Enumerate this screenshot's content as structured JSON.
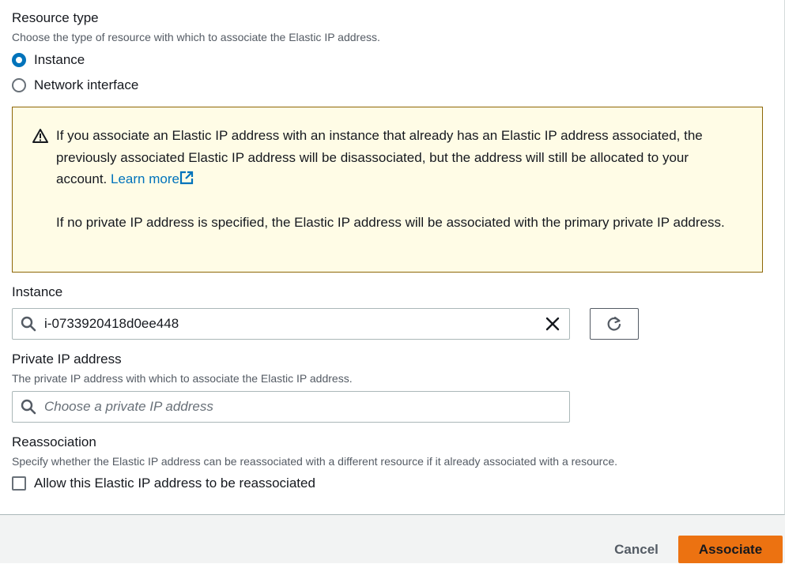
{
  "resource_type": {
    "label": "Resource type",
    "description": "Choose the type of resource with which to associate the Elastic IP address.",
    "options": [
      {
        "label": "Instance",
        "checked": true
      },
      {
        "label": "Network interface",
        "checked": false
      }
    ]
  },
  "alert": {
    "paragraph1": "If you associate an Elastic IP address with an instance that already has an Elastic IP address associated, the previously associated Elastic IP address will be disassociated, but the address will still be allocated to your account.",
    "link_text": "Learn more",
    "paragraph2": "If no private IP address is specified, the Elastic IP address will be associated with the primary private IP address.",
    "icon": "warning-icon",
    "color": "#8d6605"
  },
  "instance": {
    "label": "Instance",
    "value": "i-0733920418d0ee448"
  },
  "private_ip": {
    "label": "Private IP address",
    "description": "The private IP address with which to associate the Elastic IP address.",
    "placeholder": "Choose a private IP address"
  },
  "reassociation": {
    "label": "Reassociation",
    "description": "Specify whether the Elastic IP address can be reassociated with a different resource if it already associated with a resource.",
    "checkbox_label": "Allow this Elastic IP address to be reassociated",
    "checked": false
  },
  "footer": {
    "cancel_label": "Cancel",
    "associate_label": "Associate",
    "accent_color": "#ec7211"
  }
}
